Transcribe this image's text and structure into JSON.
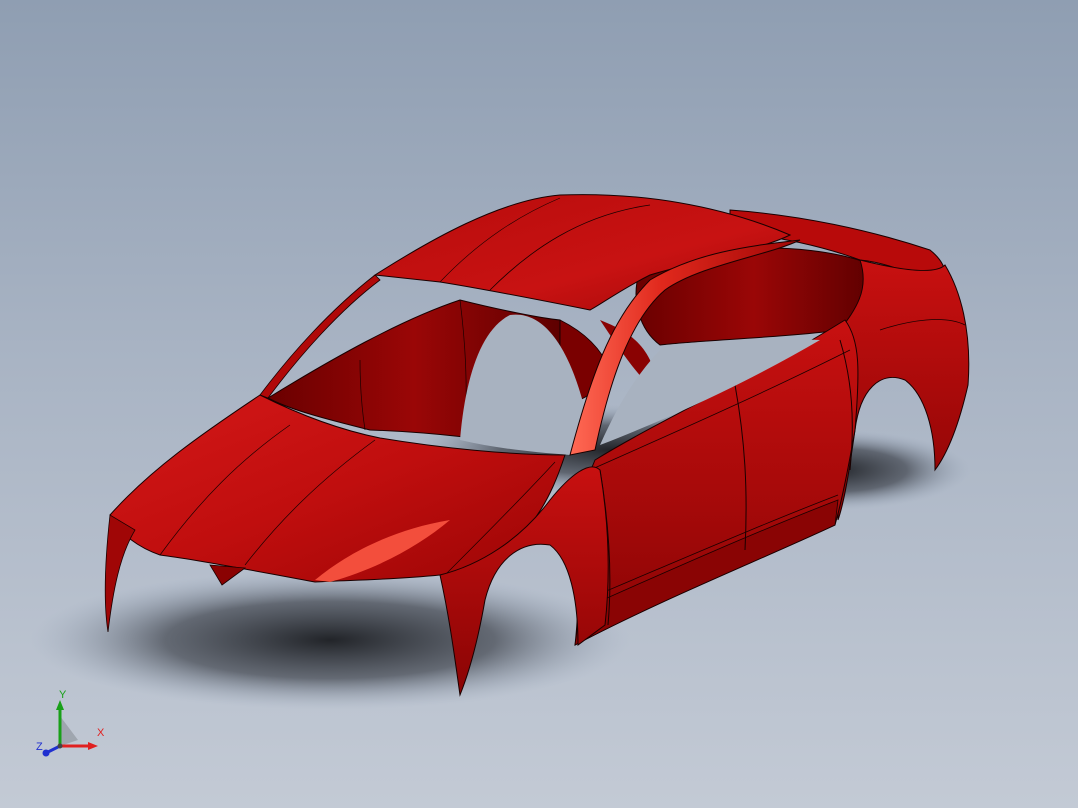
{
  "viewport": {
    "background_top": "#8f9eb2",
    "background_bottom": "#c3cad5",
    "model": {
      "body_color": "#c41010",
      "highlight_color": "#f04a3a",
      "shadow_color": "#5a0000",
      "edge_color": "#1a0000"
    }
  },
  "triad": {
    "x_label": "X",
    "y_label": "Y",
    "z_label": "Z",
    "x_color": "#e02020",
    "y_color": "#18a018",
    "z_color": "#2030d0"
  }
}
